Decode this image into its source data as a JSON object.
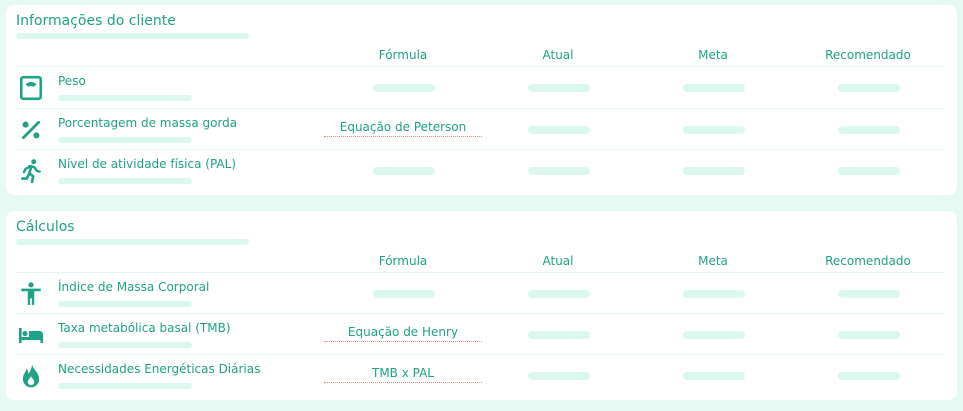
{
  "sections": [
    {
      "title": "Informações do cliente",
      "columns": [
        "Fórmula",
        "Atual",
        "Meta",
        "Recomendado"
      ],
      "rows": [
        {
          "icon": "scale-icon",
          "label": "Peso",
          "formula": ""
        },
        {
          "icon": "percent-icon",
          "label": "Porcentagem de massa gorda",
          "formula": "Equação de Peterson"
        },
        {
          "icon": "running-person-icon",
          "label": "Nível de atividade física (PAL)",
          "formula": ""
        }
      ]
    },
    {
      "title": "Cálculos",
      "columns": [
        "Fórmula",
        "Atual",
        "Meta",
        "Recomendado"
      ],
      "rows": [
        {
          "icon": "person-body-icon",
          "label": "Índice de Massa Corporal",
          "formula": ""
        },
        {
          "icon": "bed-icon",
          "label": "Taxa metabólica basal (TMB)",
          "formula": "Equação de Henry"
        },
        {
          "icon": "flame-icon",
          "label": "Necessidades Energéticas Diárias",
          "formula": "TMB x PAL"
        }
      ]
    }
  ],
  "colors": {
    "accent": "#1fa286",
    "placeholder": "#dcf7ee",
    "background": "#e6f9f2",
    "formula_underline": "#f08a7a"
  }
}
